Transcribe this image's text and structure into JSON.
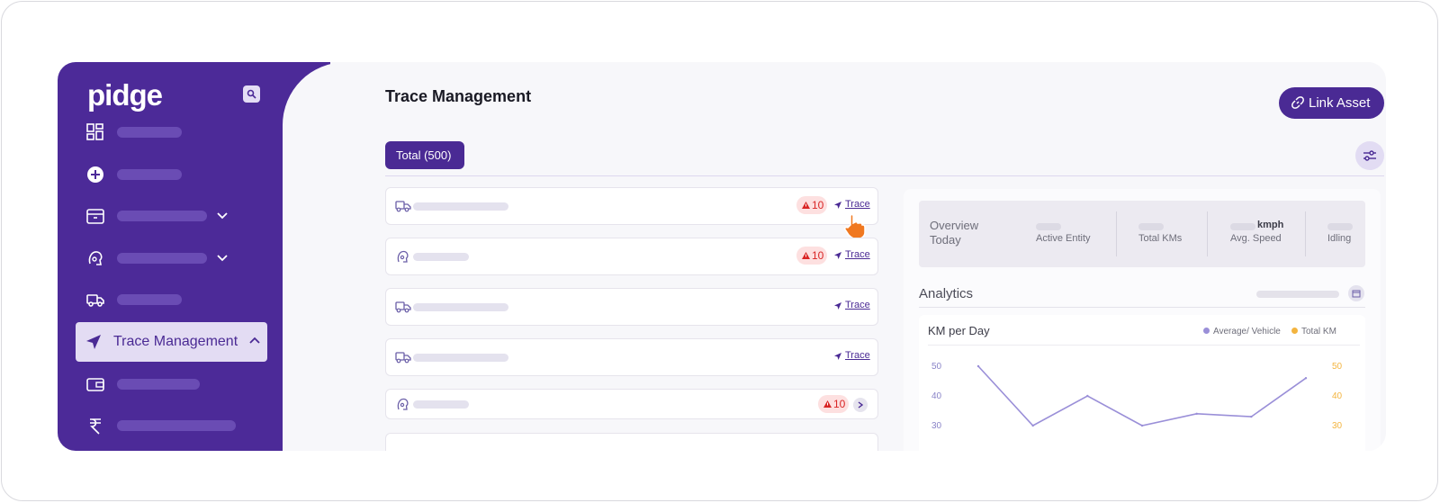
{
  "brand": {
    "logo": "pidge"
  },
  "sidebar": {
    "items": [
      {
        "icon": "dashboard-grid-icon"
      },
      {
        "icon": "plus-circle-icon"
      },
      {
        "icon": "box-icon",
        "expandable": true
      },
      {
        "icon": "rider-head-icon",
        "expandable": true
      },
      {
        "icon": "truck-icon"
      },
      {
        "icon": "navigation-arrow-icon",
        "label": "Trace Management",
        "active": true,
        "expanded": true
      },
      {
        "icon": "wallet-icon"
      },
      {
        "icon": "rupee-icon"
      }
    ]
  },
  "page": {
    "title": "Trace Management",
    "link_asset_label": "Link Asset"
  },
  "tabs": {
    "total_label": "Total (500)"
  },
  "list": {
    "rows": [
      {
        "icon": "truck-icon",
        "alert_count": "10",
        "action": "Trace"
      },
      {
        "icon": "rider-head-icon",
        "alert_count": "10",
        "action": "Trace"
      },
      {
        "icon": "truck-icon",
        "alert_count": null,
        "action": "Trace"
      },
      {
        "icon": "truck-icon",
        "alert_count": null,
        "action": "Trace"
      },
      {
        "icon": "rider-head-icon",
        "alert_count": "10",
        "action": null
      }
    ]
  },
  "overview": {
    "title": "Overview Today",
    "stats": [
      {
        "label": "Active Entity",
        "value_suffix": ""
      },
      {
        "label": "Total KMs",
        "value_suffix": ""
      },
      {
        "label": "Avg. Speed",
        "value_suffix": "kmph"
      },
      {
        "label": "Idling",
        "value_suffix": ""
      }
    ]
  },
  "analytics": {
    "title": "Analytics"
  },
  "colors": {
    "brand": "#4a2a94",
    "sidebar": "#4c2a98",
    "series_avg": "#9a8fd8",
    "series_total": "#f3b43f",
    "alert": "#d92525"
  },
  "chart_data": {
    "type": "line",
    "title": "KM per Day",
    "series": [
      {
        "name": "Average/ Vehicle",
        "values": [
          50,
          30,
          40,
          30,
          34,
          33,
          46
        ]
      },
      {
        "name": "Total KM",
        "values": []
      }
    ],
    "y_ticks_left": [
      "50",
      "40",
      "30"
    ],
    "y_ticks_right": [
      "50",
      "40",
      "30"
    ],
    "ylim": [
      30,
      50
    ],
    "grid": false,
    "legend_position": "top-right"
  }
}
